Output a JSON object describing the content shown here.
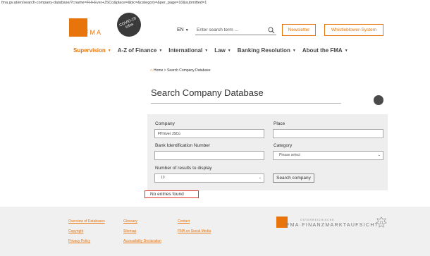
{
  "browser": {
    "url": "fma.gv.at/en/search-company-database/?cname=FH+Ever+JSCo&place=&bic=&category=&per_page=10&submitted=1"
  },
  "header": {
    "logo_text": "FMA",
    "covid_badge": "COVID-19 Infos",
    "language": "EN",
    "search_placeholder": "Enter search term ...",
    "newsletter_label": "Newsletter",
    "whistleblower_label": "Whistleblower-System"
  },
  "nav": {
    "items": [
      {
        "label": "Supervision",
        "active": true
      },
      {
        "label": "A-Z of Finance",
        "active": false
      },
      {
        "label": "International",
        "active": false
      },
      {
        "label": "Law",
        "active": false
      },
      {
        "label": "Banking Resolution",
        "active": false
      },
      {
        "label": "About the FMA",
        "active": false
      }
    ]
  },
  "breadcrumb": {
    "home": "Home",
    "separator": ">",
    "current": "Search Company Database"
  },
  "page": {
    "title": "Search Company Database"
  },
  "form": {
    "company_label": "Company",
    "company_value": "FH Ever JSCo",
    "place_label": "Place",
    "place_value": "",
    "bic_label": "Bank Identification Number",
    "bic_value": "",
    "category_label": "Category",
    "category_selected": "Please select",
    "results_label": "Number of results to display",
    "results_selected": "10",
    "submit_label": "Search company"
  },
  "results": {
    "message": "No entries found"
  },
  "footer": {
    "col1": [
      "Overview of Databases",
      "Copyright",
      "Privacy Policy"
    ],
    "col2": [
      "Glossary",
      "Sitemap",
      "Accessibility Declaration"
    ],
    "col3": [
      "Contact",
      "FMA on Social Media"
    ],
    "logo_small": "ÖSTERREICHISCHE",
    "logo_text": "FMA·FINANZMARKTAUFSICHT"
  },
  "colors": {
    "accent": "#e8750c",
    "error_border": "#e0312b",
    "form_background": "#eeeeee",
    "footer_background": "#f0f0f0"
  }
}
